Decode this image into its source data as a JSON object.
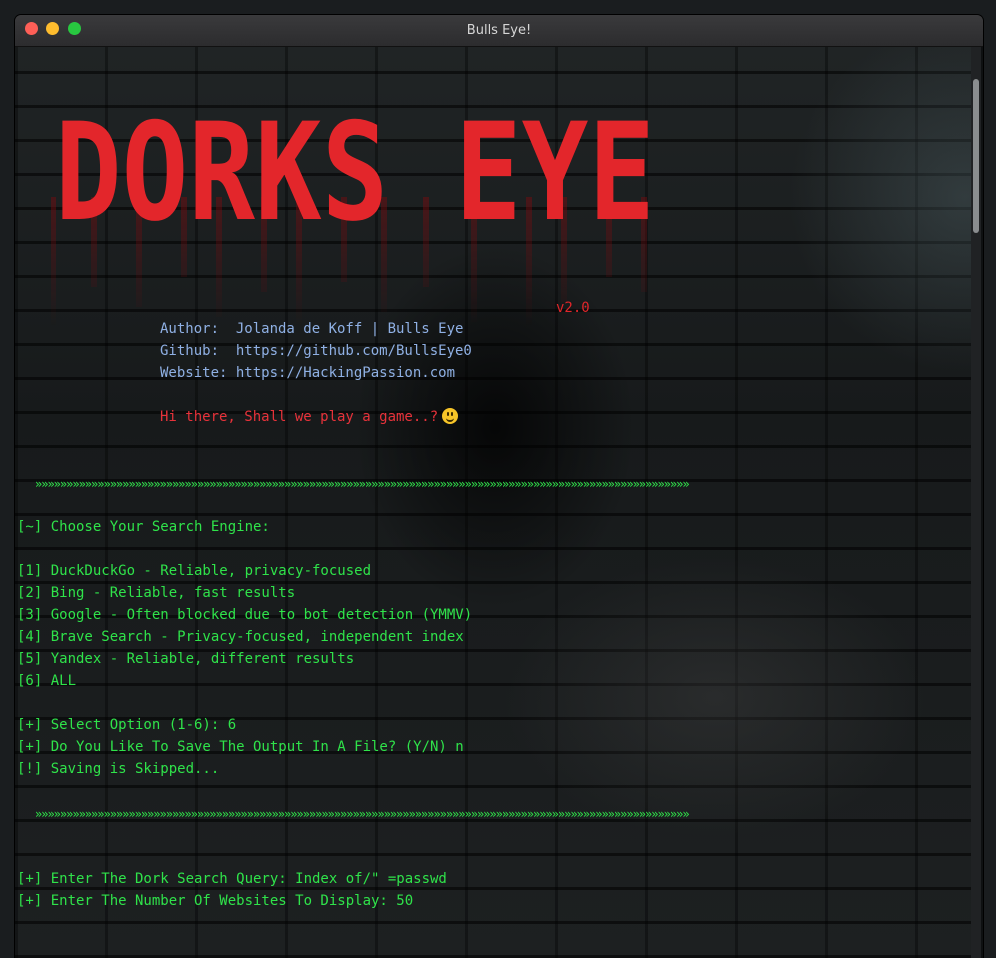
{
  "window": {
    "title": "Bulls Eye!"
  },
  "banner": {
    "title": "DORKS EYE",
    "version": "v2.0"
  },
  "info": {
    "author": "Author:  Jolanda de Koff | Bulls Eye",
    "github": "Github:  https://github.com/BullsEye0",
    "website": "Website: https://HackingPassion.com",
    "greeting": "Hi there, Shall we play a game..?"
  },
  "separator": "»»»»»»»»»»»»»»»»»»»»»»»»»»»»»»»»»»»»»»»»»»»»»»»»»»»»»»»»»»»»»»»»»»»»»»»»»»»»»»»»»»»»»»»»»»»»»»»»»»»»»»»»»",
  "menu": {
    "header": "[~] Choose Your Search Engine:",
    "options": [
      "[1] DuckDuckGo - Reliable, privacy-focused",
      "[2] Bing - Reliable, fast results",
      "[3] Google - Often blocked due to bot detection (YMMV)",
      "[4] Brave Search - Privacy-focused, independent index",
      "[5] Yandex - Reliable, different results",
      "[6] ALL"
    ]
  },
  "prompts": {
    "select": "[+] Select Option (1-6): 6",
    "save": "[+] Do You Like To Save The Output In A File? (Y/N) n",
    "skipped": "[!] Saving is Skipped...",
    "query": "[+] Enter The Dork Search Query: Index of/\" =passwd",
    "count": "[+] Enter The Number Of Websites To Display: 50"
  },
  "colors": {
    "green": "#2fe34a",
    "red": "#e7323a",
    "blue": "#8fb0e4"
  }
}
